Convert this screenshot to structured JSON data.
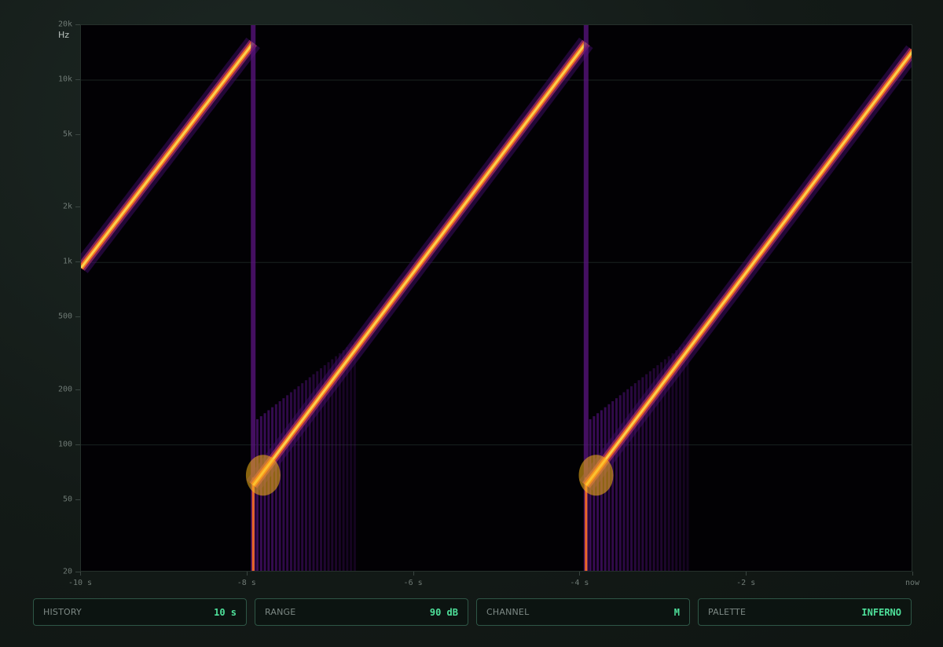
{
  "colors": {
    "accent": "#4ee09a",
    "plot_background": "#020104",
    "palette_stops": [
      "#000004",
      "#320a5e",
      "#781c6d",
      "#bc3754",
      "#ed6925",
      "#fbb61a",
      "#fcffa4"
    ]
  },
  "spectrogram": {
    "y_unit": "Hz",
    "y_axis_scale": "log",
    "y_range_hz": [
      20,
      20000
    ],
    "x_range_s": [
      -10,
      0
    ],
    "y_ticks": [
      {
        "value": 20000,
        "label": "20k"
      },
      {
        "value": 10000,
        "label": "10k"
      },
      {
        "value": 5000,
        "label": "5k"
      },
      {
        "value": 2000,
        "label": "2k"
      },
      {
        "value": 1000,
        "label": "1k"
      },
      {
        "value": 500,
        "label": "500"
      },
      {
        "value": 200,
        "label": "200"
      },
      {
        "value": 100,
        "label": "100"
      },
      {
        "value": 50,
        "label": "50"
      },
      {
        "value": 20,
        "label": "20"
      }
    ],
    "x_ticks": [
      {
        "value": -10,
        "label": "-10 s"
      },
      {
        "value": -8,
        "label": "-8 s"
      },
      {
        "value": -6,
        "label": "-6 s"
      },
      {
        "value": -4,
        "label": "-4 s"
      },
      {
        "value": -2,
        "label": "-2 s"
      },
      {
        "value": 0,
        "label": "now"
      }
    ],
    "gridlines_hz": [
      10000,
      1000,
      100
    ],
    "sweeps": [
      {
        "t_start": -12,
        "t_end": -7.93,
        "f_start_hz": 60,
        "f_end_hz": 16000
      },
      {
        "t_start": -7.93,
        "t_end": -3.93,
        "f_start_hz": 60,
        "f_end_hz": 16000
      },
      {
        "t_start": -3.93,
        "t_end": 0.07,
        "f_start_hz": 60,
        "f_end_hz": 16000
      }
    ]
  },
  "controls": [
    {
      "label": "HISTORY",
      "value": "10 s"
    },
    {
      "label": "RANGE",
      "value": "90 dB"
    },
    {
      "label": "CHANNEL",
      "value": "M"
    },
    {
      "label": "PALETTE",
      "value": "INFERNO"
    }
  ]
}
